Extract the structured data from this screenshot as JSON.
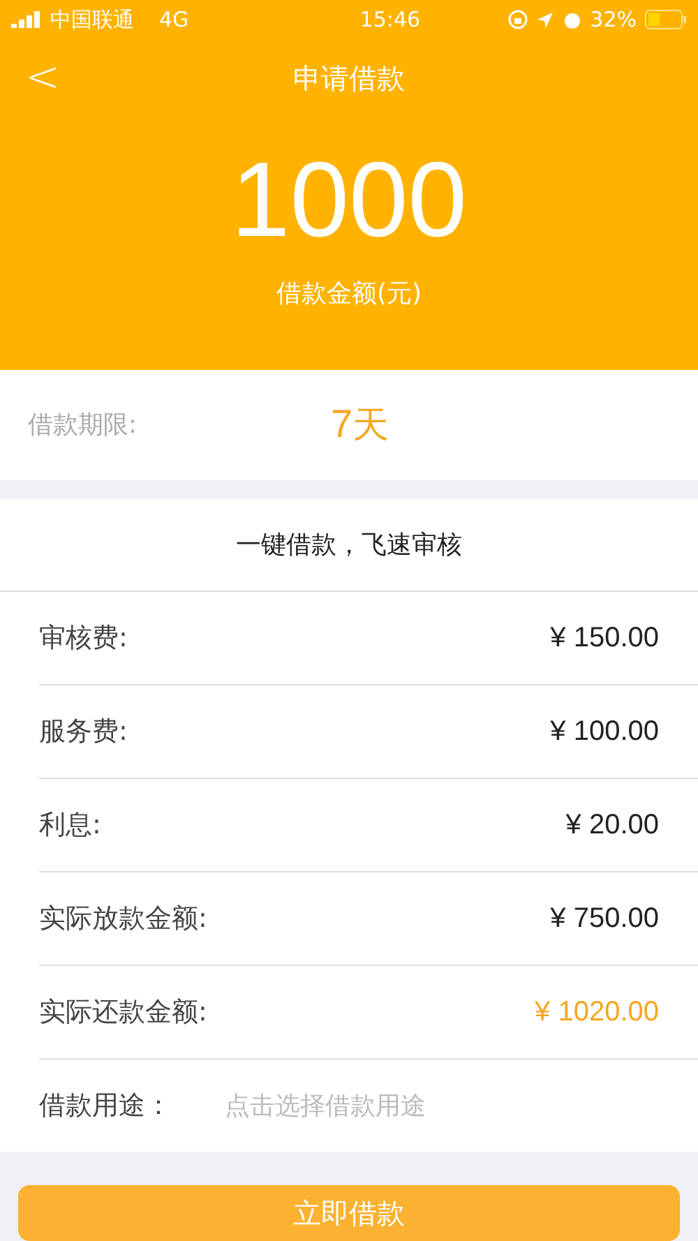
{
  "status_bar": {
    "carrier": "中国联通",
    "network": "4G",
    "time": "15:46",
    "battery": "32%"
  },
  "header": {
    "back": "<",
    "title": "申请借款"
  },
  "amount": {
    "value": "1000",
    "label": "借款金额(元)"
  },
  "term": {
    "label": "借款期限:",
    "number": "7",
    "unit": "天"
  },
  "slogan": "一键借款，飞速审核",
  "fees": [
    {
      "label": "审核费:",
      "value": "¥ 150.00",
      "highlight": false
    },
    {
      "label": "服务费:",
      "value": "¥ 100.00",
      "highlight": false
    },
    {
      "label": "利息:",
      "value": "¥ 20.00",
      "highlight": false
    },
    {
      "label": "实际放款金额:",
      "value": "¥ 750.00",
      "highlight": false
    },
    {
      "label": "实际还款金额:",
      "value": "¥ 1020.00",
      "highlight": true
    }
  ],
  "purpose": {
    "label": "借款用途：",
    "placeholder": "点击选择借款用途"
  },
  "submit": "立即借款"
}
